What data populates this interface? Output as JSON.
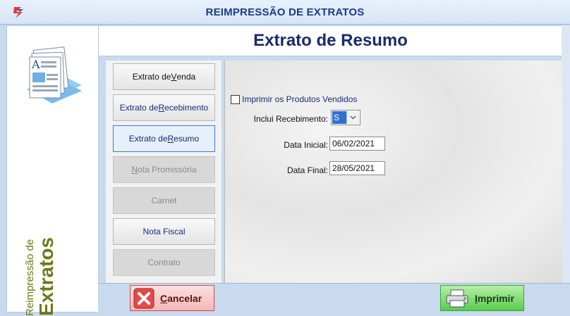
{
  "window": {
    "title": "REIMPRESSÃO DE EXTRATOS"
  },
  "left_panel": {
    "caption_small": "Reimpressão de",
    "caption_big": "Extratos"
  },
  "header": {
    "title": "Extrato de Resumo"
  },
  "menu": {
    "items": [
      {
        "label_pre": "Extrato de ",
        "label_ul": "V",
        "label_post": "enda",
        "state": "normal"
      },
      {
        "label_pre": "Extrato de ",
        "label_ul": "R",
        "label_post": "ecebimento",
        "state": "blue"
      },
      {
        "label_pre": "Extrato de ",
        "label_ul": "R",
        "label_post": "esumo",
        "state": "selected"
      },
      {
        "label_pre": "",
        "label_ul": "N",
        "label_post": "ota Promissória",
        "state": "disabled"
      },
      {
        "label_pre": "Carnet",
        "label_ul": "",
        "label_post": "",
        "state": "disabled"
      },
      {
        "label_pre": "Nota Fiscal",
        "label_ul": "",
        "label_post": "",
        "state": "blue"
      },
      {
        "label_pre": "Contrato",
        "label_ul": "",
        "label_post": "",
        "state": "disabled"
      }
    ]
  },
  "form": {
    "print_products_label": "Imprimir os Produtos Vendidos",
    "print_products_checked": false,
    "inclui_recebimento_label": "Inclui Recebimento:",
    "inclui_recebimento_value": "S",
    "data_inicial_label": "Data Inicial:",
    "data_inicial_value": "06/02/2021",
    "data_final_label": "Data Final:",
    "data_final_value": "28/05/2021"
  },
  "buttons": {
    "cancel": {
      "ul": "C",
      "rest": "ancelar"
    },
    "print": {
      "ul": "I",
      "rest": "mprimir"
    }
  },
  "colors": {
    "title_blue": "#1a3c8c",
    "accent_olive": "#6b7a1a",
    "select_blue": "#2f6fce"
  },
  "icons": [
    "app-logo-icon",
    "documents-icon",
    "cancel-x-icon",
    "printer-icon",
    "chevron-down-icon"
  ]
}
